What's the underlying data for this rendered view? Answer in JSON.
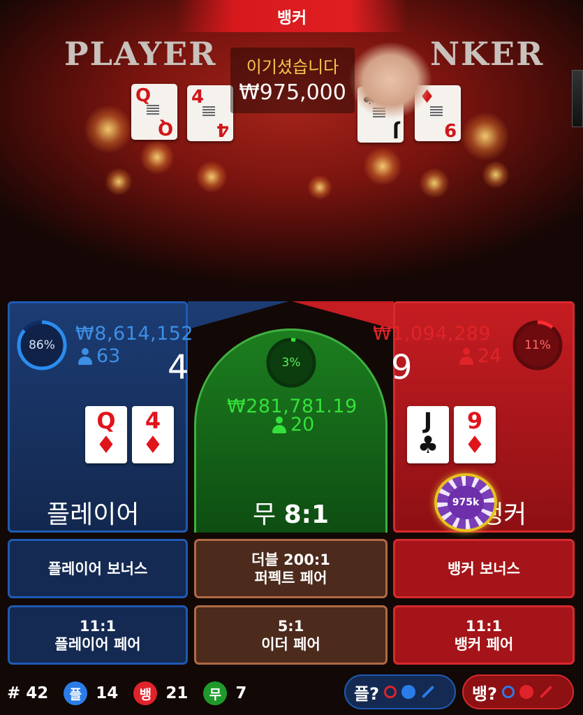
{
  "video": {
    "table_player_text": "PLAYER",
    "table_banker_text": "NKER",
    "winner_banner": "뱅커",
    "win_message": "이기셨습니다",
    "win_amount": "₩975,000",
    "player_cards": [
      {
        "rank": "Q",
        "suit": "♦"
      },
      {
        "rank": "4",
        "suit": "♦"
      }
    ],
    "banker_cards": [
      {
        "rank": "J",
        "suit": "♣"
      },
      {
        "rank": "9",
        "suit": "♦"
      }
    ]
  },
  "player": {
    "percent": "86%",
    "percent_value": 86,
    "amount": "₩8,614,152",
    "count": "63",
    "score": "4",
    "cards": [
      {
        "rank": "Q",
        "suit": "♦"
      },
      {
        "rank": "4",
        "suit": "♦"
      }
    ],
    "label": "플레이어"
  },
  "tie": {
    "percent": "3%",
    "percent_value": 3,
    "amount": "₩281,781.19",
    "count": "20",
    "label": "무",
    "odds": "8:1"
  },
  "banker": {
    "percent": "11%",
    "percent_value": 11,
    "amount": "₩1,094,289",
    "count": "24",
    "score": "9",
    "cards": [
      {
        "rank": "J",
        "suit": "♣"
      },
      {
        "rank": "9",
        "suit": "♦"
      }
    ],
    "label": "뱅커",
    "chip": "975k"
  },
  "side_bets": {
    "player_bonus": "플레이어 보너스",
    "perfect_pair_line1": "더블 200:1",
    "perfect_pair_line2": "퍼펙트 페어",
    "banker_bonus": "뱅커 보너스",
    "player_pair_line1": "11:1",
    "player_pair_line2": "플레이어 페어",
    "either_pair_line1": "5:1",
    "either_pair_line2": "이더 페어",
    "banker_pair_line1": "11:1",
    "banker_pair_line2": "뱅커 페어"
  },
  "stats": {
    "round_label": "# 42",
    "player_short": "플",
    "player_wins": "14",
    "banker_short": "뱅",
    "banker_wins": "21",
    "tie_short": "무",
    "ties": "7",
    "predict_player": "플?",
    "predict_banker": "뱅?"
  },
  "colors": {
    "player_blue": "#1f5ab4",
    "banker_red": "#d62a2e",
    "tie_green": "#3fb041",
    "win_gold": "#f2c94c"
  }
}
